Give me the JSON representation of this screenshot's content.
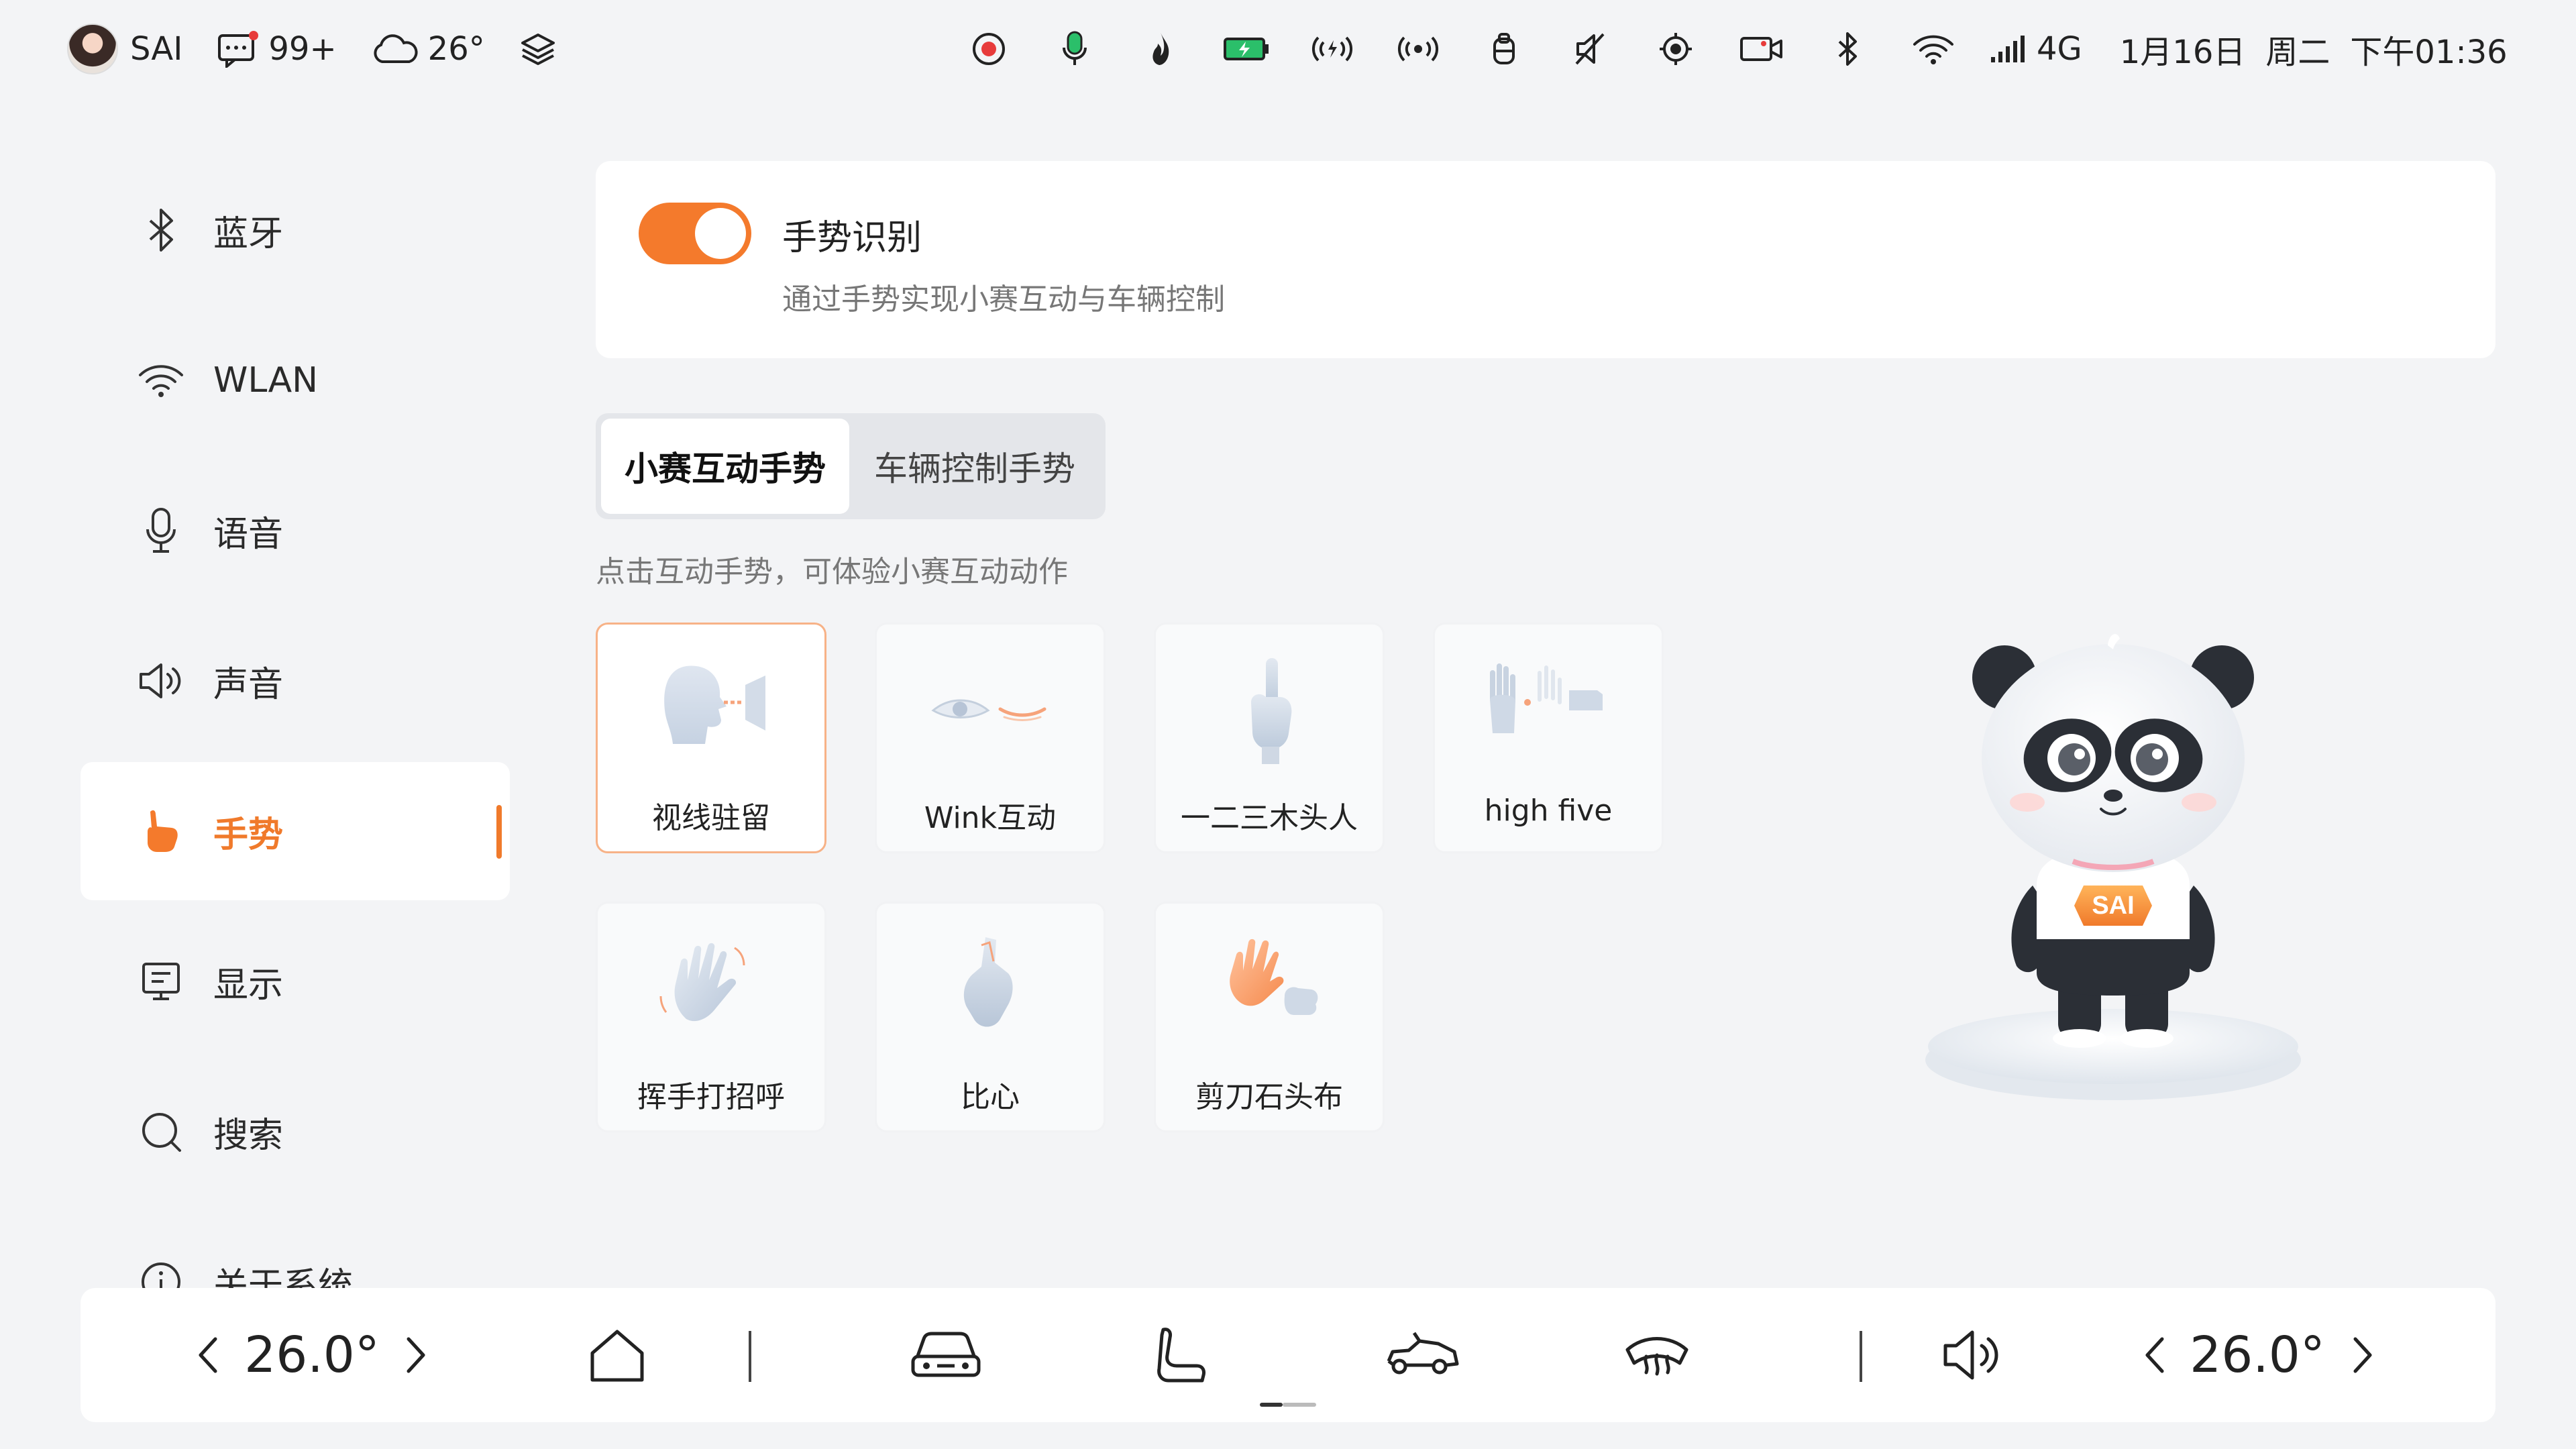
{
  "status_bar": {
    "user_name": "SAI",
    "message_count": "99+",
    "weather_temp": "26°",
    "network": "4G",
    "date": "1月16日",
    "weekday": "周二",
    "time": "下午01:36",
    "icons": [
      "record-icon",
      "mic-icon",
      "flame-icon",
      "battery-icon",
      "broadcast-icon",
      "radio-signal-icon",
      "seatbelt-icon",
      "mute-icon",
      "tpms-icon",
      "dashcam-icon",
      "bluetooth-icon",
      "wifi-icon",
      "cell-signal-icon"
    ]
  },
  "sidebar": {
    "items": [
      {
        "label": "蓝牙",
        "icon": "bluetooth-icon"
      },
      {
        "label": "WLAN",
        "icon": "wifi-icon"
      },
      {
        "label": "语音",
        "icon": "microphone-icon"
      },
      {
        "label": "声音",
        "icon": "speaker-icon"
      },
      {
        "label": "手势",
        "icon": "hand-icon",
        "active": true
      },
      {
        "label": "显示",
        "icon": "display-icon"
      },
      {
        "label": "搜索",
        "icon": "search-icon"
      },
      {
        "label": "关于系统",
        "icon": "info-icon"
      }
    ]
  },
  "gesture_toggle": {
    "title": "手势识别",
    "description": "通过手势实现小赛互动与车辆控制",
    "enabled": true
  },
  "tabs": [
    {
      "label": "小赛互动手势",
      "active": true
    },
    {
      "label": "车辆控制手势",
      "active": false
    }
  ],
  "hint": "点击互动手势，可体验小赛互动动作",
  "gestures": [
    {
      "label": "视线驻留",
      "icon": "gaze-icon",
      "selected": true
    },
    {
      "label": "Wink互动",
      "icon": "wink-icon"
    },
    {
      "label": "一二三木头人",
      "icon": "finger-up-icon"
    },
    {
      "label": "high five",
      "icon": "high-five-icon"
    },
    {
      "label": "挥手打招呼",
      "icon": "wave-hand-icon"
    },
    {
      "label": "比心",
      "icon": "finger-heart-icon"
    },
    {
      "label": "剪刀石头布",
      "icon": "rock-paper-scissors-icon"
    }
  ],
  "mascot": {
    "badge": "SAI"
  },
  "dock": {
    "left_temp": "26.0°",
    "right_temp": "26.0°",
    "icons": [
      "home-icon",
      "car-icon",
      "seat-icon",
      "car-open-icon",
      "defrost-icon",
      "volume-icon"
    ]
  },
  "colors": {
    "accent": "#f47a2c",
    "background": "#f3f4f6",
    "card": "#ffffff"
  }
}
